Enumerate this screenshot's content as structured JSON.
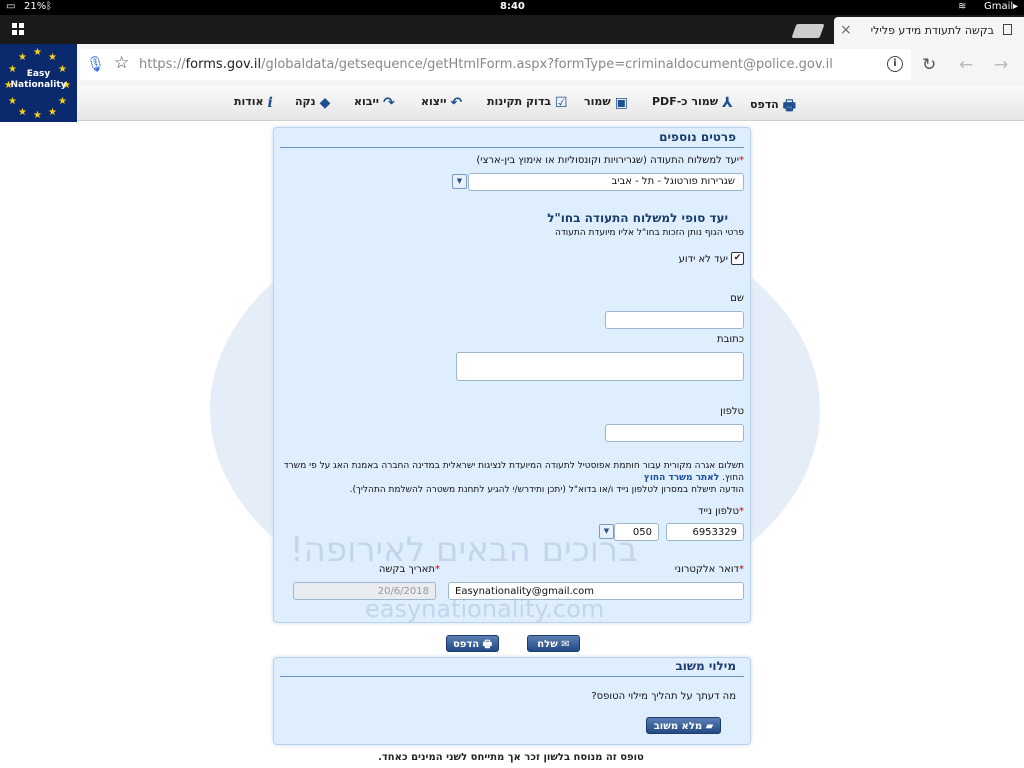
{
  "status": {
    "battery": "21%",
    "time": "8:40",
    "carrier": "Gmail"
  },
  "tabs": {
    "active_title": "בקשה לתעודת מידע פלילי"
  },
  "address": {
    "url_prefix": "https://",
    "url_domain": "forms.gov.il",
    "url_path": "/globaldata/getsequence/getHtmlForm.aspx?formType=criminaldocument@police.gov.il"
  },
  "logo": {
    "line1": "Easy",
    "line2": "Nationality"
  },
  "toolbar": {
    "print": "הדפס",
    "save_pdf": "שמור כ-PDF",
    "save": "שמור",
    "validate": "בדוק תקינות",
    "export": "ייצוא",
    "import": "ייבוא",
    "clear": "נקה",
    "about": "אודות"
  },
  "form": {
    "section_title": "פרטים נוספים",
    "destination_label": "יעד למשלוח התעודה (שגרירויות וקונסוליות או אימוץ בין-ארצי)",
    "destination_value": "שגרירות פורטוגל - תל - אביב",
    "final_dest_title": "יעד סופי למשלוח התעודה בחו\"ל",
    "final_dest_sub": "פרטי הגוף נותן הזכות בחו\"ל אליו מיועדת התעודה",
    "unknown_dest_label": "יעד לא ידוע",
    "name_label": "שם",
    "address_label": "כתובת",
    "phone_label": "טלפון",
    "fee_text": "תשלום אגרה מקורית עבור חותמת אפוסטיל לתעודה המיועדת לנציגות ישראלית במדינה החברה באמנת האג על פי משרד",
    "fee_text2": "החוץ.",
    "fee_link": "לאתר משרד החוץ",
    "notice_text": "הודעה תישלח במסרון לטלפון נייד ו/או בדוא\"ל (יתכן ותידרש/י להגיע לתחנת משטרה להשלמת התהליך).",
    "mobile_label": "טלפון נייד",
    "mobile_number": "6953329",
    "mobile_prefix": "050",
    "email_label": "דואר אלקטרוני",
    "email_value": "Easynationality@gmail.com",
    "date_label": "תאריך בקשה",
    "date_value": "20/6/2018",
    "watermark_he": "ברוכים הבאים לאירופה!",
    "watermark_url": "easynationality.com"
  },
  "actions": {
    "send": "שלח",
    "print": "הדפס"
  },
  "feedback": {
    "title": "מילוי משוב",
    "question": "מה דעתך על תהליך מילוי הטופס?",
    "button": "מלא משוב"
  },
  "footer_note": "טופס זה מנוסח בלשון זכר אך מתייחס לשני המינים כאחד.",
  "colors": {
    "accent": "#1a3d6e",
    "panel": "#dfeefc",
    "button": "#234a85",
    "logo_bg": "#0b2a6e"
  }
}
